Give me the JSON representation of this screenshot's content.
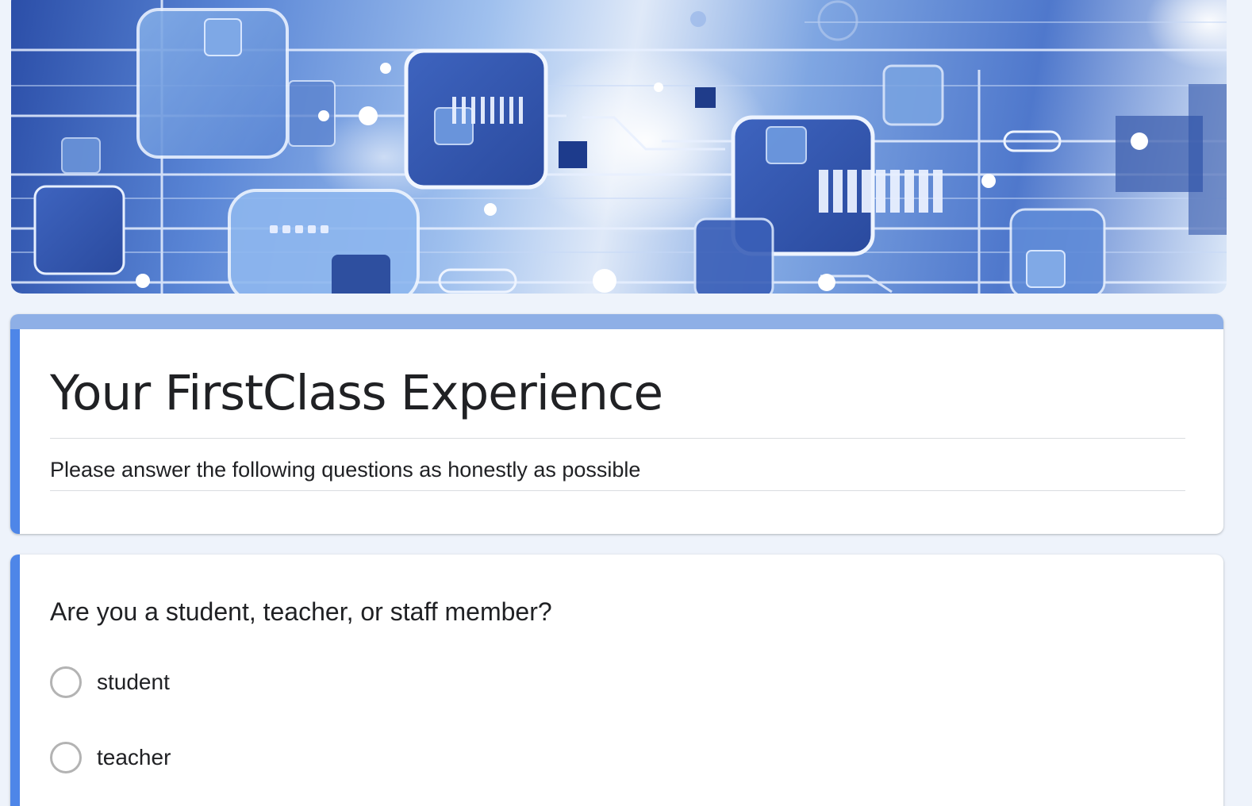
{
  "form": {
    "title": "Your FirstClass Experience",
    "description": "Please answer the following questions as honestly as possible"
  },
  "question": {
    "text": "Are you a student, teacher, or staff member?",
    "options": [
      {
        "label": "student",
        "selected": false
      },
      {
        "label": "teacher",
        "selected": false
      }
    ]
  },
  "theme": {
    "background": "#eef3fb",
    "accent": "#4e86e8",
    "title_bar": "#8eafe6"
  },
  "banner": {
    "image": "blue-circuit-technology-illustration"
  }
}
